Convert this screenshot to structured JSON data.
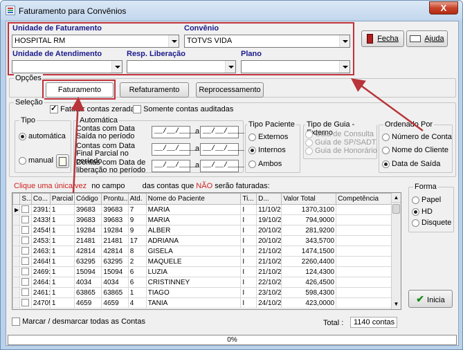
{
  "window": {
    "title": "Faturamento para Convênios",
    "close_label": "X"
  },
  "top": {
    "unidade_faturamento_label": "Unidade de Faturamento",
    "unidade_faturamento_value": "HOSPITAL RM",
    "convenio_label": "Convênio",
    "convenio_value": "TOTVS VIDA",
    "unidade_atendimento_label": "Unidade de Atendimento",
    "unidade_atendimento_value": "",
    "resp_liberacao_label": "Resp. Liberação",
    "resp_liberacao_value": "",
    "plano_label": "Plano",
    "plano_value": ""
  },
  "toolbar": {
    "fecha_label": "Fecha",
    "ajuda_label": "Ajuda"
  },
  "opcoes": {
    "title": "Opções",
    "faturamento": "Faturamento",
    "refaturamento": "Refaturamento",
    "reprocessamento": "Reprocessamento"
  },
  "selecao": {
    "title": "Seleção",
    "faturar_zeradas": "Faturar contas zeradas",
    "somente_auditadas": "Somente contas auditadas",
    "tipo_title": "Tipo",
    "tipo_automatica": "automática",
    "tipo_manual": "manual",
    "automatica_title": "Automática",
    "data_saida": "Contas com Data Saída no período",
    "data_final": "Contas com Data Final Parcial no período",
    "data_liberacao": "Contas com Data de liberação no período",
    "date_mask": "__/__/____",
    "a": "a",
    "tipo_paciente_title": "Tipo Paciente",
    "externos": "Externos",
    "internos": "Internos",
    "ambos": "Ambos",
    "tipo_guia_title": "Tipo de Guia - Externo",
    "guia_consulta": "Guia de Consulta",
    "guia_sp": "Guia de SP/SADT",
    "guia_honorario": "Guia de Honorário",
    "ordenado_title": "Ordenado Por",
    "num_conta": "Número de Conta",
    "nome_cliente": "Nome do Cliente",
    "data_saida_ord": "Data de Saída"
  },
  "hint": {
    "part1": "Clique uma única vez",
    "part2": "no campo",
    "part3": "das contas que",
    "part4": "NÃO",
    "part5": "serão faturadas:"
  },
  "table": {
    "headers": [
      "S...",
      "Co...",
      "Parcial",
      "Código",
      "Prontu...",
      "Atd.",
      "Nome do Paciente",
      "Ti...",
      "D...",
      "Valor Total",
      "Competência"
    ],
    "rows": [
      [
        "2391:",
        "1",
        "39683",
        "39683",
        "7",
        "MARIA",
        "I",
        "11/10/2",
        "1370,3100",
        ""
      ],
      [
        "2433!",
        "1",
        "39683",
        "39683",
        "9",
        "MARIA",
        "I",
        "19/10/2",
        "794,9000",
        ""
      ],
      [
        "2454!",
        "1",
        "19284",
        "19284",
        "9",
        "ALBER",
        "I",
        "20/10/2",
        "281,9200",
        ""
      ],
      [
        "2453:",
        "1",
        "21481",
        "21481",
        "17",
        "ADRIANA",
        "I",
        "20/10/2",
        "343,5700",
        ""
      ],
      [
        "2463:",
        "1",
        "42814",
        "42814",
        "8",
        "GISELA",
        "I",
        "21/10/2",
        "1474,1500",
        ""
      ],
      [
        "2464!",
        "1",
        "63295",
        "63295",
        "2",
        "MAQUELE",
        "I",
        "21/10/2",
        "2260,4400",
        ""
      ],
      [
        "2469:",
        "1",
        "15094",
        "15094",
        "6",
        "LUZIA",
        "I",
        "21/10/2",
        "124,4300",
        ""
      ],
      [
        "2464:",
        "1",
        "4034",
        "4034",
        "6",
        "CRISTINNEY",
        "I",
        "22/10/2",
        "426,4500",
        ""
      ],
      [
        "2461:",
        "1",
        "63865",
        "63865",
        "1",
        "TIAGO",
        "I",
        "23/10/2",
        "598,4300",
        ""
      ],
      [
        "2470!",
        "1",
        "4659",
        "4659",
        "4",
        "TANIA",
        "I",
        "24/10/2",
        "423,0000",
        ""
      ]
    ]
  },
  "forma": {
    "title": "Forma",
    "papel": "Papel",
    "hd": "HD",
    "disquete": "Disquete"
  },
  "inicia_label": "Inicia",
  "footer": {
    "marcar": "Marcar / desmarcar todas as Contas",
    "total_label": "Total :",
    "total_value": "1140 contas"
  },
  "progress": {
    "text": "0%",
    "value": 0
  },
  "colors": {
    "highlight": "#c0303a",
    "label_blue": "#1a1a8c",
    "hint_red": "#d02020"
  }
}
